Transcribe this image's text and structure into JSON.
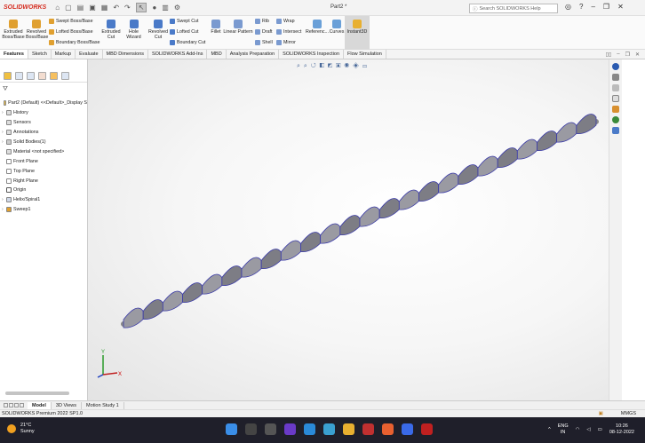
{
  "app": {
    "logo_text": "SOLIDWORKS",
    "document_title": "Part2 *",
    "search_placeholder": "Search SOLIDWORKS Help"
  },
  "ribbon": {
    "extruded_boss": "Extruded Boss/Base",
    "revolved_boss": "Revolved Boss/Base",
    "swept_boss": "Swept Boss/Base",
    "lofted_boss": "Lofted Boss/Base",
    "boundary_boss": "Boundary Boss/Base",
    "extruded_cut": "Extruded Cut",
    "hole_wizard": "Hole Wizard",
    "revolved_cut": "Revolved Cut",
    "swept_cut": "Swept Cut",
    "lofted_cut": "Lofted Cut",
    "boundary_cut": "Boundary Cut",
    "fillet": "Fillet",
    "linear_pattern": "Linear Pattern",
    "rib": "Rib",
    "draft": "Draft",
    "shell": "Shell",
    "wrap": "Wrap",
    "intersect": "Intersect",
    "mirror": "Mirror",
    "reference": "Referenc...",
    "curves": "Curves",
    "instant3d": "Instant3D"
  },
  "tabs": [
    "Features",
    "Sketch",
    "Markup",
    "Evaluate",
    "MBD Dimensions",
    "SOLIDWORKS Add-Ins",
    "MBD",
    "Analysis Preparation",
    "SOLIDWORKS Inspection",
    "Flow Simulation"
  ],
  "tree": {
    "filter_icon": "filter-icon",
    "items": [
      {
        "label": "Part2 (Default) <<Default>_Display S",
        "expand": ""
      },
      {
        "label": "History",
        "expand": "›"
      },
      {
        "label": "Sensors",
        "expand": ""
      },
      {
        "label": "Annotations",
        "expand": "›"
      },
      {
        "label": "Solid Bodies(1)",
        "expand": "›"
      },
      {
        "label": "Material <not specified>",
        "expand": ""
      },
      {
        "label": "Front Plane",
        "expand": ""
      },
      {
        "label": "Top Plane",
        "expand": ""
      },
      {
        "label": "Right Plane",
        "expand": ""
      },
      {
        "label": "Origin",
        "expand": ""
      },
      {
        "label": "Helix/Spiral1",
        "expand": "›"
      },
      {
        "label": "Sweep1",
        "expand": "›"
      }
    ]
  },
  "bottom_tabs": [
    "Model",
    "3D Views",
    "Motion Study 1"
  ],
  "status": {
    "left": "SOLIDWORKS Premium 2022 SP1.0",
    "units": "MMGS"
  },
  "taskbar": {
    "temp": "21°C",
    "weather": "Sunny",
    "lang1": "ENG",
    "lang2": "IN",
    "time": "10:26",
    "date": "08-12-2022"
  },
  "triad": {
    "x_label": "X",
    "y_label": "Y"
  },
  "colors": {
    "accent": "#d52b1e",
    "model_edge": "#3a3aa8",
    "taskbar": "#1f1f2a"
  }
}
